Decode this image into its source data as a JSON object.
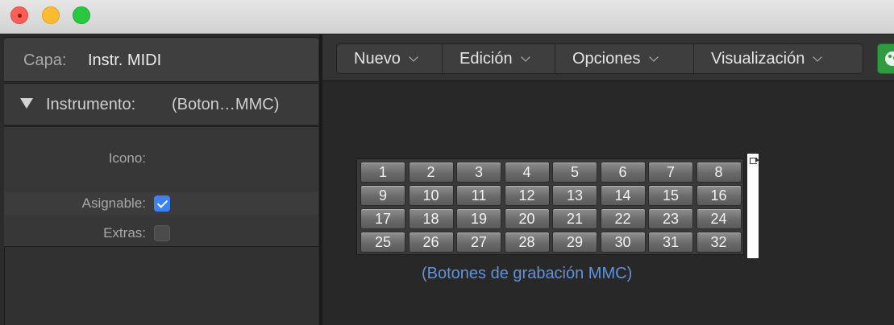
{
  "window": {
    "controls": [
      "close",
      "minimize",
      "zoom"
    ]
  },
  "inspector": {
    "layer": {
      "label": "Capa:",
      "value": "Instr. MIDI"
    },
    "instrument": {
      "label": "Instrumento:",
      "value": "(Boton…MMC)"
    },
    "fields": {
      "icon_label": "Icono:",
      "assignable_label": "Asignable:",
      "assignable_checked": true,
      "extras_label": "Extras:",
      "extras_checked": false
    }
  },
  "toolbar": {
    "menus": [
      "Nuevo",
      "Edición",
      "Opciones",
      "Visualización"
    ],
    "color_button_icon": "palette-icon",
    "color_button_color": "#2f9b3f"
  },
  "canvas": {
    "object": {
      "buttons": [
        "1",
        "2",
        "3",
        "4",
        "5",
        "6",
        "7",
        "8",
        "9",
        "10",
        "11",
        "12",
        "13",
        "14",
        "15",
        "16",
        "17",
        "18",
        "19",
        "20",
        "21",
        "22",
        "23",
        "24",
        "25",
        "26",
        "27",
        "28",
        "29",
        "30",
        "31",
        "32"
      ],
      "caption": "(Botones de grabación MMC)",
      "caption_color": "#5f93da"
    }
  }
}
